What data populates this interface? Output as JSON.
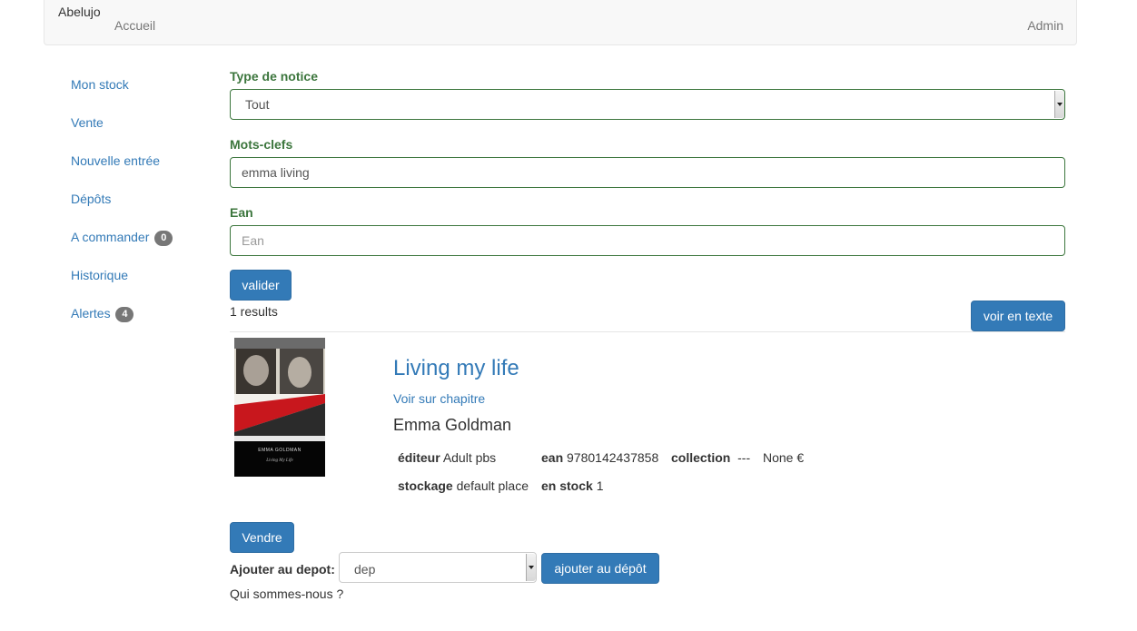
{
  "navbar": {
    "brand": "Abelujo",
    "home": "Accueil",
    "admin": "Admin"
  },
  "sidebar": {
    "items": [
      {
        "label": "Mon stock"
      },
      {
        "label": "Vente"
      },
      {
        "label": "Nouvelle entrée"
      },
      {
        "label": "Dépôts"
      },
      {
        "label": "A commander",
        "badge": "0"
      },
      {
        "label": "Historique"
      },
      {
        "label": "Alertes",
        "badge": "4"
      }
    ]
  },
  "search": {
    "type_label": "Type de notice",
    "type_value": "Tout",
    "keywords_label": "Mots-clefs",
    "keywords_value": "emma living",
    "ean_label": "Ean",
    "ean_placeholder": "Ean",
    "submit_label": "valider"
  },
  "results": {
    "count_text": "1 results",
    "text_view_label": "voir en texte"
  },
  "book": {
    "title": "Living my life",
    "chapter_link": "Voir sur chapitre",
    "author": "Emma Goldman",
    "cover_author": "EMMA GOLDMAN",
    "cover_title": "Living My Life",
    "editor_label": "éditeur",
    "editor_value": "Adult pbs",
    "ean_label": "ean",
    "ean_value": "9780142437858",
    "collection_label": "collection",
    "collection_value": "---",
    "price": "None €",
    "storage_label": "stockage",
    "storage_value": "default place",
    "stock_label": "en stock",
    "stock_value": "1"
  },
  "actions": {
    "sell_label": "Vendre",
    "deposit_label": "Ajouter au depot:",
    "deposit_value": "dep",
    "add_deposit_label": "ajouter au dépôt"
  },
  "footer": {
    "about": "Qui sommes-nous ?"
  }
}
